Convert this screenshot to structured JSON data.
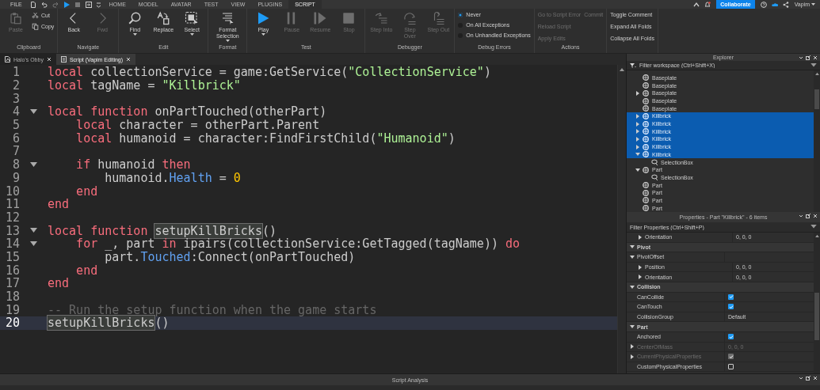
{
  "menu_bar": {
    "file_menu": "FILE",
    "tabs": [
      {
        "label": "HOME",
        "selected": false
      },
      {
        "label": "MODEL",
        "selected": false
      },
      {
        "label": "AVATAR",
        "selected": false
      },
      {
        "label": "TEST",
        "selected": false
      },
      {
        "label": "VIEW",
        "selected": false
      },
      {
        "label": "PLUGINS",
        "selected": false
      },
      {
        "label": "SCRIPT",
        "selected": true
      }
    ],
    "collaborate_button": "Collaborate",
    "user": "Vapim"
  },
  "ribbon": {
    "groups": [
      {
        "label": "Clipboard",
        "columns": [
          [
            {
              "kind": "large",
              "label": "Paste",
              "disabled": true
            }
          ],
          [
            {
              "kind": "small",
              "label": "Cut",
              "disabled": false
            },
            {
              "kind": "small",
              "label": "Copy",
              "disabled": false
            }
          ]
        ]
      },
      {
        "label": "Navigate",
        "columns": [
          [
            {
              "kind": "large",
              "label": "Back",
              "disabled": false
            }
          ],
          [
            {
              "kind": "large",
              "label": "Fwd",
              "disabled": true
            }
          ]
        ]
      },
      {
        "label": "Edit",
        "columns": [
          [
            {
              "kind": "large",
              "label": "Find",
              "disabled": false,
              "dropdown": true
            }
          ],
          [
            {
              "kind": "large",
              "label": "Replace",
              "disabled": false
            }
          ],
          [
            {
              "kind": "large",
              "label": "Select",
              "disabled": false,
              "dropdown": true
            }
          ]
        ]
      },
      {
        "label": "Format",
        "columns": [
          [
            {
              "kind": "large",
              "label": "Format Selection",
              "disabled": false,
              "dropdown": true
            }
          ]
        ]
      },
      {
        "label": "Test",
        "columns": [
          [
            {
              "kind": "large",
              "label": "Play",
              "disabled": false,
              "dropdown": true
            }
          ],
          [
            {
              "kind": "large",
              "label": "Pause",
              "disabled": true
            }
          ],
          [
            {
              "kind": "large",
              "label": "Resume",
              "disabled": true
            }
          ],
          [
            {
              "kind": "large",
              "label": "Stop",
              "disabled": true
            }
          ]
        ]
      },
      {
        "label": "Debugger",
        "columns": [
          [
            {
              "kind": "large",
              "label": "Step Into",
              "disabled": true
            }
          ],
          [
            {
              "kind": "large",
              "label": "Step Over",
              "disabled": true
            }
          ],
          [
            {
              "kind": "large",
              "label": "Step Out",
              "disabled": true
            }
          ]
        ]
      },
      {
        "label": "Debug Errors",
        "columns": [
          [
            {
              "kind": "radio",
              "label": "Never",
              "selected": true
            },
            {
              "kind": "radio",
              "label": "On All Exceptions",
              "selected": false
            },
            {
              "kind": "radio",
              "label": "On Unhandled Exceptions",
              "selected": false
            }
          ]
        ]
      },
      {
        "label": "Actions",
        "columns": [
          [
            {
              "kind": "text",
              "label": "Go to Script Error",
              "disabled": true
            },
            {
              "kind": "text",
              "label": "Reload Script",
              "disabled": true
            },
            {
              "kind": "text",
              "label": "Apply Edits",
              "disabled": true
            }
          ],
          [
            {
              "kind": "text",
              "label": "Commit",
              "disabled": true
            }
          ]
        ]
      },
      {
        "columns": [
          [
            {
              "kind": "text",
              "label": "Toggle Comment",
              "disabled": false
            },
            {
              "kind": "text",
              "label": "Expand All Folds",
              "disabled": false
            },
            {
              "kind": "text",
              "label": "Collapse All Folds",
              "disabled": false
            }
          ]
        ]
      }
    ]
  },
  "editor_tabs": [
    {
      "kind": "place",
      "label": "Halo's Obby",
      "selected": false
    },
    {
      "kind": "script",
      "label": "Script (Vapim Editing)",
      "selected": true
    }
  ],
  "code": {
    "lines": [
      {
        "number": "1",
        "fold": false,
        "current": false,
        "tokens": [
          {
            "kind": "keyword",
            "text": "local"
          },
          {
            "kind": "plain",
            "text": " collectionService = game:GetService("
          },
          {
            "kind": "string",
            "text": "\"CollectionService\""
          },
          {
            "kind": "plain",
            "text": ")"
          }
        ]
      },
      {
        "number": "2",
        "fold": false,
        "current": false,
        "tokens": [
          {
            "kind": "keyword",
            "text": "local"
          },
          {
            "kind": "plain",
            "text": " tagName = "
          },
          {
            "kind": "string",
            "text": "\"Killbrick\""
          }
        ]
      },
      {
        "number": "3",
        "fold": false,
        "current": false
      },
      {
        "number": "4",
        "fold": true,
        "current": false,
        "tokens": [
          {
            "kind": "keyword",
            "text": "local function"
          },
          {
            "kind": "plain",
            "text": " onPartTouched(otherPart)"
          }
        ]
      },
      {
        "number": "5",
        "fold": false,
        "current": false,
        "tokens": [
          {
            "kind": "keyword",
            "text": "    local"
          },
          {
            "kind": "plain",
            "text": " character = otherPart.Parent"
          }
        ]
      },
      {
        "number": "6",
        "fold": false,
        "current": false,
        "tokens": [
          {
            "kind": "keyword",
            "text": "    local"
          },
          {
            "kind": "plain",
            "text": " humanoid = character:FindFirstChild("
          },
          {
            "kind": "string",
            "text": "\"Humanoid\""
          },
          {
            "kind": "plain",
            "text": ")"
          }
        ]
      },
      {
        "number": "7",
        "fold": false,
        "current": false
      },
      {
        "number": "8",
        "fold": true,
        "current": false,
        "tokens": [
          {
            "kind": "keyword",
            "text": "    if"
          },
          {
            "kind": "plain",
            "text": " humanoid "
          },
          {
            "kind": "keyword",
            "text": "then"
          }
        ]
      },
      {
        "number": "9",
        "fold": false,
        "current": false,
        "tokens": [
          {
            "kind": "plain",
            "text": "        humanoid."
          },
          {
            "kind": "property",
            "text": "Health"
          },
          {
            "kind": "plain",
            "text": " = "
          },
          {
            "kind": "number",
            "text": "0"
          }
        ]
      },
      {
        "number": "10",
        "fold": false,
        "current": false,
        "tokens": [
          {
            "kind": "keyword",
            "text": "    end"
          }
        ]
      },
      {
        "number": "11",
        "fold": false,
        "current": false,
        "tokens": [
          {
            "kind": "keyword",
            "text": "end"
          }
        ]
      },
      {
        "number": "12",
        "fold": false,
        "current": false
      },
      {
        "number": "13",
        "fold": true,
        "current": false,
        "tokens": [
          {
            "kind": "keyword",
            "text": "local function"
          },
          {
            "kind": "match",
            "text": " setupKillBricks"
          },
          {
            "kind": "plain",
            "text": "()"
          }
        ]
      },
      {
        "number": "14",
        "fold": true,
        "current": false,
        "tokens": [
          {
            "kind": "keyword",
            "text": "    for"
          },
          {
            "kind": "plain",
            "text": " _, part "
          },
          {
            "kind": "keyword",
            "text": "in"
          },
          {
            "kind": "plain",
            "text": " ipairs(collectionService:GetTagged(tagName)) "
          },
          {
            "kind": "keyword",
            "text": "do"
          }
        ]
      },
      {
        "number": "15",
        "fold": false,
        "current": false,
        "tokens": [
          {
            "kind": "plain",
            "text": "        part."
          },
          {
            "kind": "property",
            "text": "Touched"
          },
          {
            "kind": "plain",
            "text": ":Connect(onPartTouched)"
          }
        ]
      },
      {
        "number": "16",
        "fold": false,
        "current": false,
        "tokens": [
          {
            "kind": "keyword",
            "text": "    end"
          }
        ]
      },
      {
        "number": "17",
        "fold": false,
        "current": false,
        "tokens": [
          {
            "kind": "keyword",
            "text": "end"
          }
        ]
      },
      {
        "number": "18",
        "fold": false,
        "current": false
      },
      {
        "number": "19",
        "fold": false,
        "current": false,
        "tokens": [
          {
            "kind": "comment",
            "text": "-- Run the setup function when the game starts"
          }
        ]
      },
      {
        "number": "20",
        "fold": false,
        "current": true,
        "tokens": [
          {
            "kind": "match",
            "text": "setupKillBricks"
          },
          {
            "kind": "plain",
            "text": "()"
          }
        ]
      }
    ]
  },
  "explorer": {
    "title": "Explorer",
    "filter": {
      "placeholder": "Filter workspace (Ctrl+Shift+X)"
    },
    "items": [
      {
        "kind": "part",
        "name": "Baseplate",
        "selected": false
      },
      {
        "kind": "part",
        "name": "Baseplate",
        "selected": false
      },
      {
        "kind": "part",
        "name": "Baseplate",
        "selected": false,
        "expanded": false
      },
      {
        "kind": "part",
        "name": "Baseplate",
        "selected": false
      },
      {
        "kind": "part",
        "name": "Baseplate",
        "selected": false
      },
      {
        "kind": "part",
        "name": "Killbrick",
        "selected": true,
        "expanded": false
      },
      {
        "kind": "part",
        "name": "Killbrick",
        "selected": true,
        "expanded": false
      },
      {
        "kind": "part",
        "name": "Killbrick",
        "selected": true,
        "expanded": false
      },
      {
        "kind": "part",
        "name": "Killbrick",
        "selected": true,
        "expanded": false
      },
      {
        "kind": "part",
        "name": "Killbrick",
        "selected": true,
        "expanded": false
      },
      {
        "kind": "part",
        "name": "Killbrick",
        "selected": true,
        "expanded": true,
        "children": [
          {
            "kind": "selection_box",
            "name": "SelectionBox",
            "selected": false
          }
        ]
      },
      {
        "kind": "part",
        "name": "Part",
        "selected": false,
        "expanded": true,
        "children": [
          {
            "kind": "selection_box",
            "name": "SelectionBox",
            "selected": false
          }
        ]
      },
      {
        "kind": "part",
        "name": "Part",
        "selected": false
      },
      {
        "kind": "part",
        "name": "Part",
        "selected": false
      },
      {
        "kind": "part",
        "name": "Part",
        "selected": false
      },
      {
        "kind": "part",
        "name": "Part",
        "selected": false
      }
    ]
  },
  "properties": {
    "title": "Properties - Part \"Killbrick\" - 6 items",
    "filter": {
      "placeholder": "Filter Properties (Ctrl+Shift+P)"
    },
    "rows": [
      {
        "kind": "value",
        "name": "Orientation",
        "value": "0, 0, 0",
        "expanded": false,
        "disabled": false
      },
      {
        "kind": "category",
        "name": "Pivot",
        "expanded": true,
        "children": [
          {
            "kind": "value",
            "name": "PivotOffset",
            "expanded": true,
            "disabled": false,
            "children": [
              {
                "kind": "value",
                "name": "Position",
                "value": "0, 0, 0",
                "expanded": false,
                "disabled": false
              },
              {
                "kind": "value",
                "name": "Orientation",
                "value": "0, 0, 0",
                "expanded": false,
                "disabled": false
              }
            ]
          }
        ]
      },
      {
        "kind": "category",
        "name": "Collision",
        "expanded": true,
        "children": [
          {
            "kind": "bool",
            "name": "CanCollide",
            "checked": true,
            "disabled": false
          },
          {
            "kind": "bool",
            "name": "CanTouch",
            "checked": true,
            "disabled": false
          },
          {
            "kind": "value",
            "name": "CollisionGroup",
            "value": "Default",
            "disabled": false
          }
        ]
      },
      {
        "kind": "category",
        "name": "Part",
        "expanded": true,
        "children": [
          {
            "kind": "bool",
            "name": "Anchored",
            "checked": true,
            "disabled": false
          },
          {
            "kind": "value",
            "name": "CenterOfMass",
            "value": "0, 0, 0",
            "expanded": false,
            "disabled": true
          },
          {
            "kind": "bool",
            "name": "CurrentPhysicalProperties",
            "checked": true,
            "expanded": false,
            "disabled": true
          },
          {
            "kind": "bool",
            "name": "CustomPhysicalProperties",
            "checked": false,
            "disabled": false
          }
        ]
      }
    ]
  },
  "bottom_panel": {
    "title": "Script Analysis"
  }
}
